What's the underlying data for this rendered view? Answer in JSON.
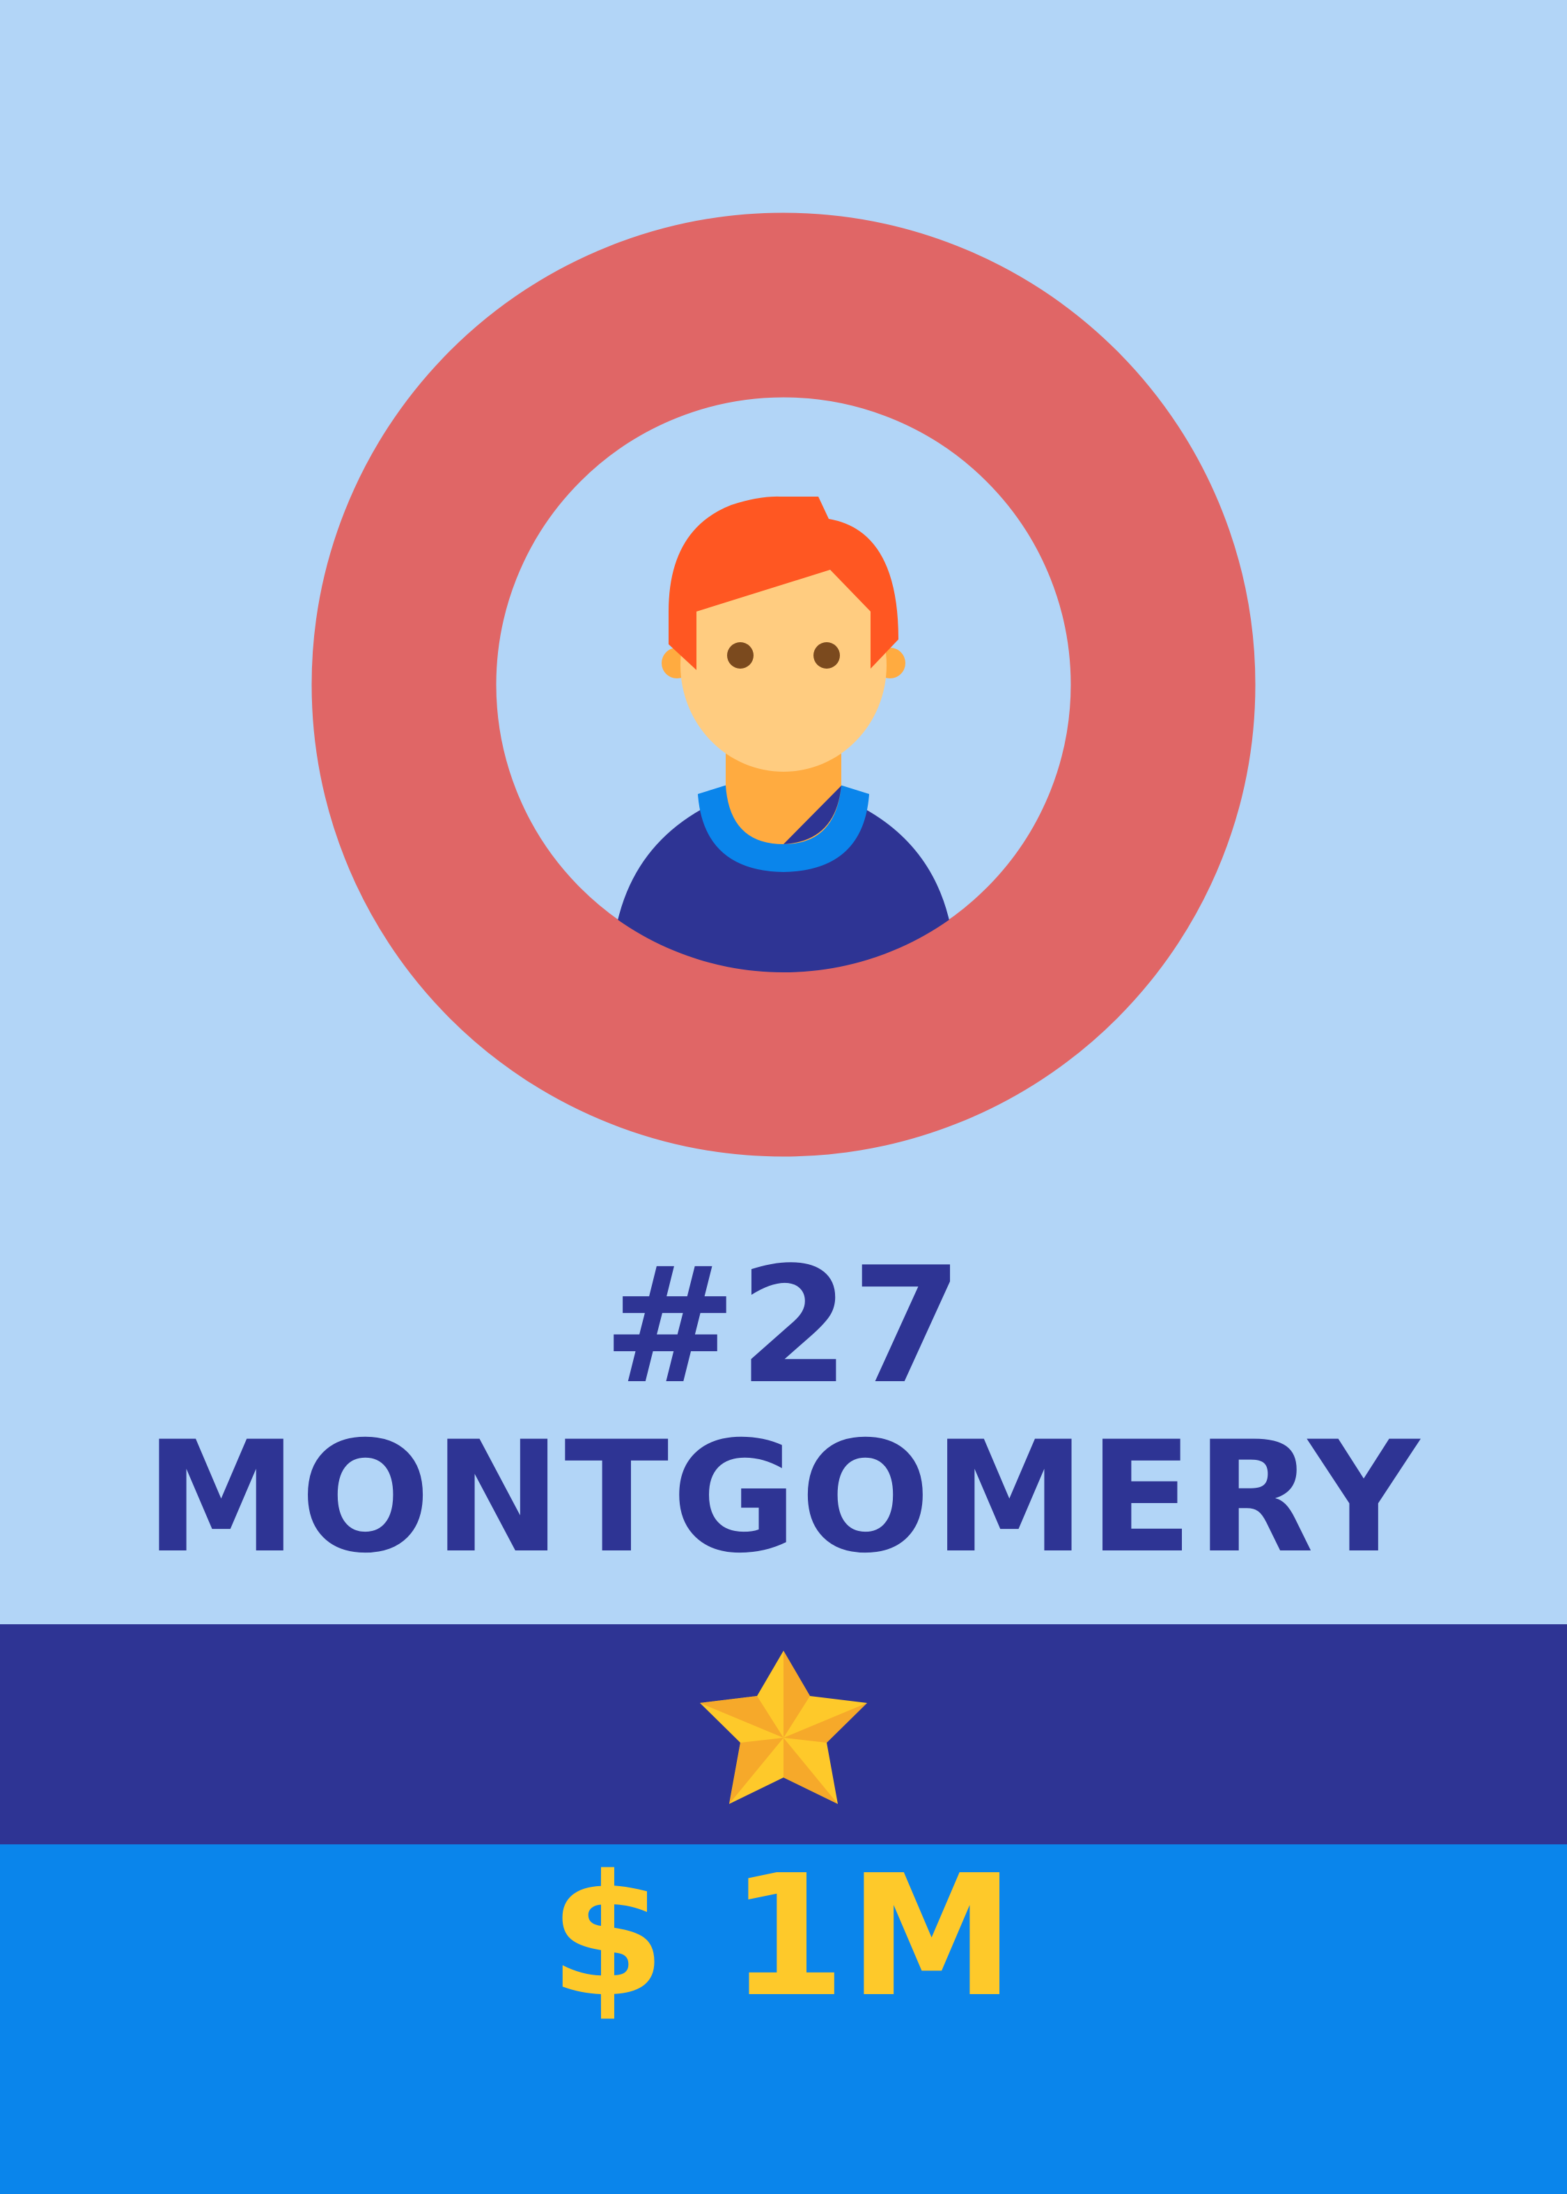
{
  "card": {
    "number": "#27",
    "name": "MONTGOMERY",
    "value": "$ 1M"
  },
  "icons": {
    "portrait": "person-avatar-icon",
    "star": "star-icon"
  },
  "colors": {
    "background": "#b2d5f7",
    "ring": "#e06666",
    "navy": "#2e3494",
    "blue": "#0a85eb",
    "gold": "#fec92a",
    "hair": "#ff5722",
    "skin": "#ffcc80",
    "neck": "#ffab40"
  }
}
